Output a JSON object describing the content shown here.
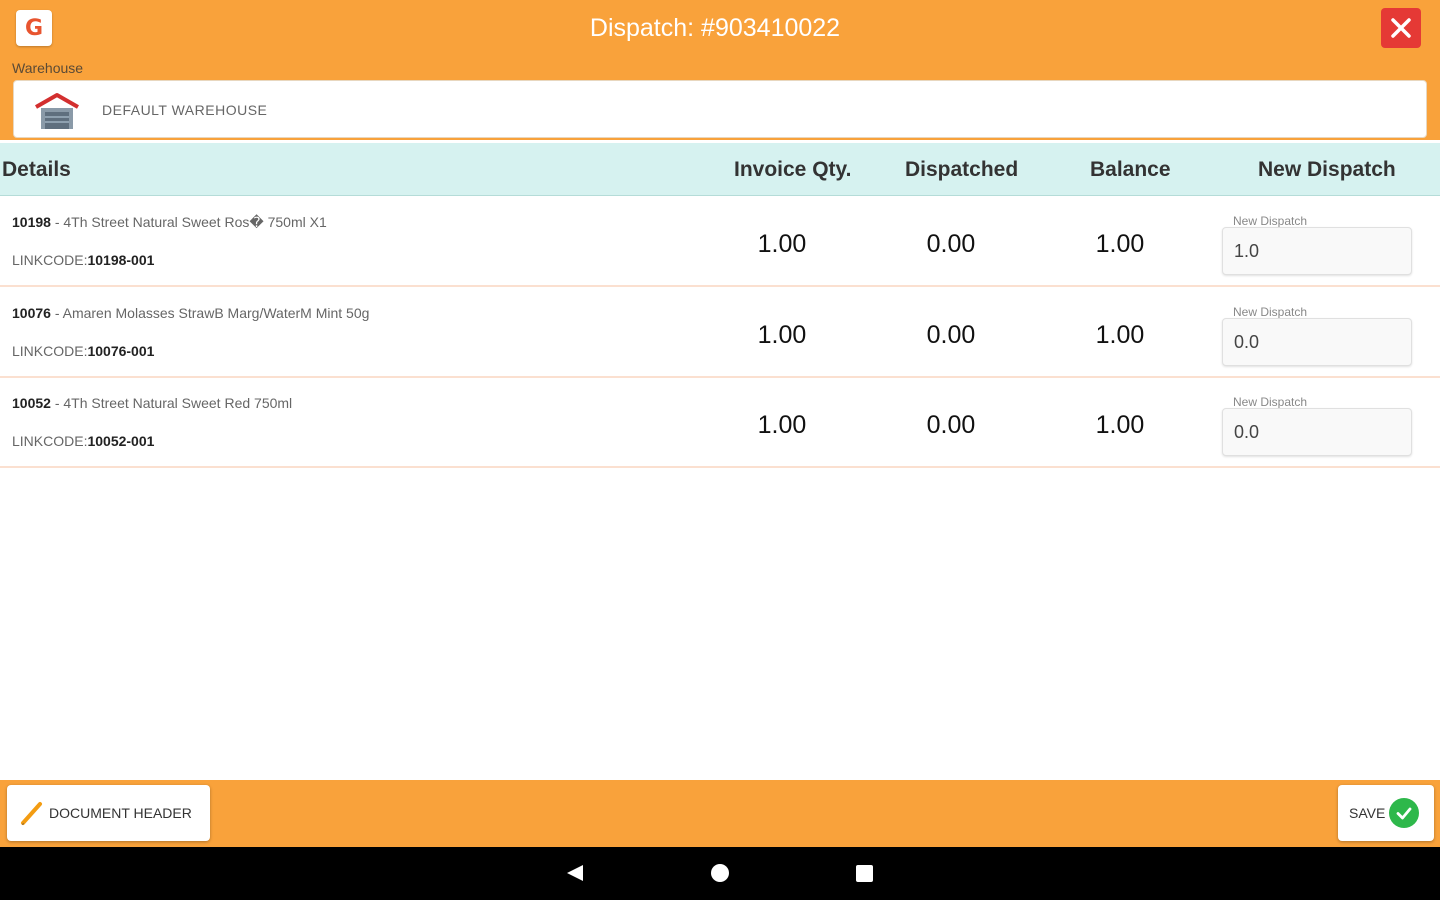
{
  "header": {
    "title": "Dispatch: #903410022",
    "logo_icon": "app-logo-icon",
    "logo_letter": "G",
    "close_icon": "close-icon",
    "bg_color": "#F9A23B"
  },
  "warehouse": {
    "label": "Warehouse",
    "name": "DEFAULT WAREHOUSE",
    "icon": "warehouse-icon"
  },
  "table": {
    "columns": {
      "details": "Details",
      "invoice_qty": "Invoice Qty.",
      "dispatched": "Dispatched",
      "balance": "Balance",
      "new_dispatch": "New Dispatch"
    },
    "rows": [
      {
        "code": "10198",
        "separator": " - ",
        "description": "4Th Street Natural Sweet Ros� 750ml X1",
        "linkcode_label": "LINKCODE:",
        "linkcode": "10198-001",
        "invoice_qty": "1.00",
        "dispatched": "0.00",
        "balance": "1.00",
        "new_dispatch_label": "New Dispatch",
        "new_dispatch_value": "1.0"
      },
      {
        "code": "10076",
        "separator": " - ",
        "description": "Amaren Molasses StrawB Marg/WaterM Mint 50g",
        "linkcode_label": "LINKCODE:",
        "linkcode": "10076-001",
        "invoice_qty": "1.00",
        "dispatched": "0.00",
        "balance": "1.00",
        "new_dispatch_label": "New Dispatch",
        "new_dispatch_value": "0.0"
      },
      {
        "code": "10052",
        "separator": " - ",
        "description": "4Th Street Natural Sweet Red 750ml",
        "linkcode_label": "LINKCODE:",
        "linkcode": "10052-001",
        "invoice_qty": "1.00",
        "dispatched": "0.00",
        "balance": "1.00",
        "new_dispatch_label": "New Dispatch",
        "new_dispatch_value": "0.0"
      }
    ]
  },
  "footer": {
    "document_header_label": "DOCUMENT HEADER",
    "document_header_icon": "pencil-icon",
    "save_label": "SAVE",
    "save_icon": "check-circle-icon"
  },
  "system_nav": {
    "back_icon": "back-icon",
    "home_icon": "home-icon",
    "recent_icon": "recent-apps-icon"
  }
}
